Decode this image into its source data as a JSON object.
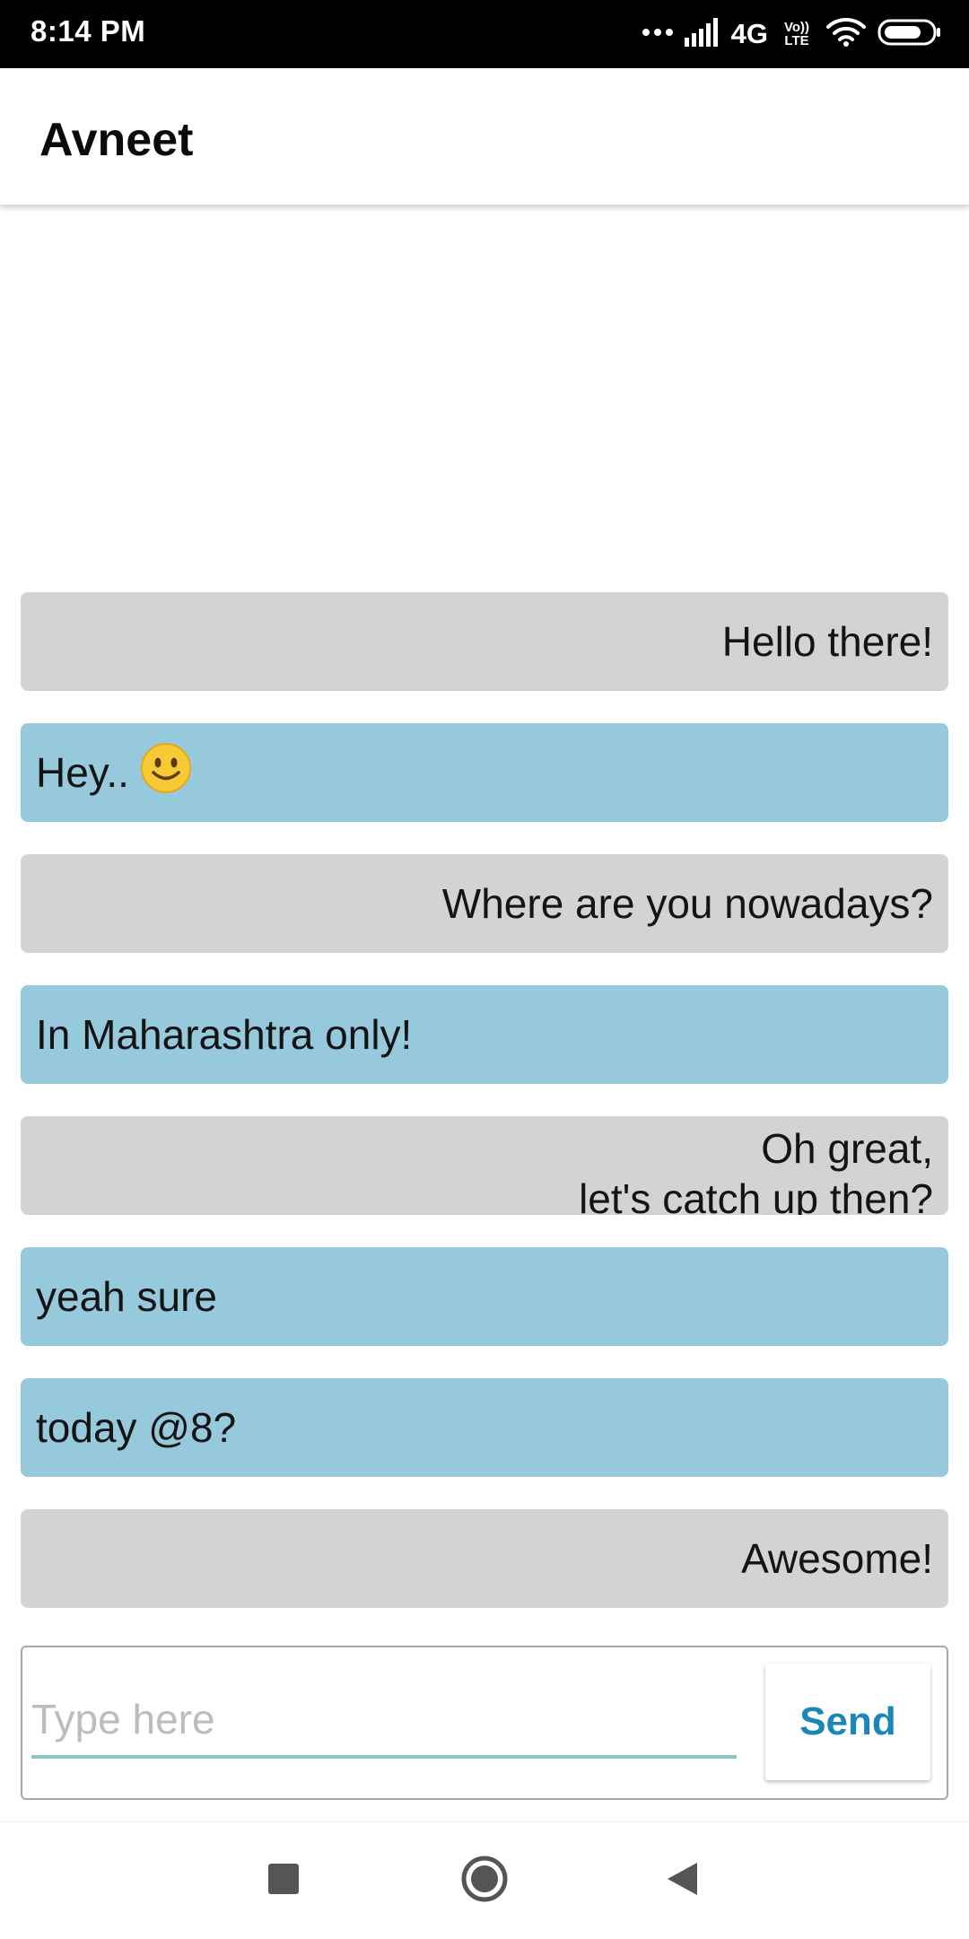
{
  "status_bar": {
    "time": "8:14 PM",
    "network": "4G",
    "volte_top": "Vo))",
    "volte_bottom": "LTE",
    "icons": [
      "more-dots-icon",
      "signal-icon",
      "volte-icon",
      "wifi-icon",
      "battery-icon"
    ]
  },
  "header": {
    "title": "Avneet"
  },
  "messages": [
    {
      "text": "Hello there!",
      "side": "outgoing"
    },
    {
      "text": "Hey..",
      "side": "incoming",
      "emoji": "smile-emoji-icon"
    },
    {
      "text": "Where are you nowadays?",
      "side": "outgoing"
    },
    {
      "text": "In Maharashtra only!",
      "side": "incoming"
    },
    {
      "lines": [
        "Oh great,",
        "let's catch up then?"
      ],
      "side": "outgoing"
    },
    {
      "text": "yeah sure",
      "side": "incoming"
    },
    {
      "text": "today @8?",
      "side": "incoming"
    },
    {
      "text": "Awesome!",
      "side": "outgoing"
    }
  ],
  "composer": {
    "placeholder": "Type here",
    "value": "",
    "send_label": "Send"
  },
  "navigation": {
    "icons": [
      "recents-square-icon",
      "home-circle-icon",
      "back-triangle-icon"
    ]
  },
  "colors": {
    "outgoing_bubble": "#d3d3d3",
    "incoming_bubble": "#97c9dc",
    "accent": "#1a87b7",
    "input_underline": "#88c8c4"
  }
}
